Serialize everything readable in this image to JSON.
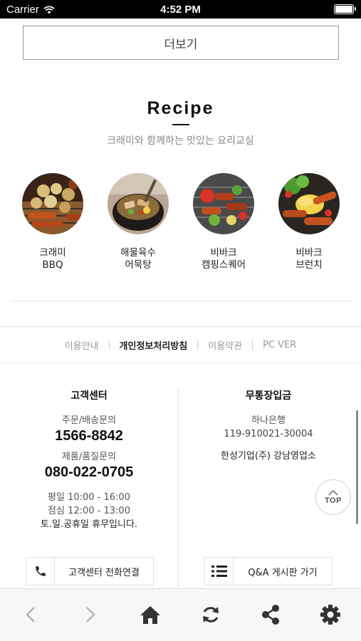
{
  "status_bar": {
    "carrier": "Carrier",
    "time": "4:52 PM"
  },
  "more_button": {
    "label": "더보기"
  },
  "recipe": {
    "title": "Recipe",
    "subtitle": "크래미와 함께하는 맛있는 요리교실",
    "items": [
      {
        "line1": "크래미",
        "line2": "BBQ"
      },
      {
        "line1": "해물육수",
        "line2": "어묵탕"
      },
      {
        "line1": "비바크",
        "line2": "캠핑스퀘어"
      },
      {
        "line1": "비바크",
        "line2": "브런치"
      }
    ]
  },
  "footer_links": [
    "이용안내",
    "개인정보처리방침",
    "이용약관",
    "PC VER"
  ],
  "customer_center": {
    "title": "고객센터",
    "order_label": "주문/배송문의",
    "order_phone": "1566-8842",
    "product_label": "제품/품질문의",
    "product_phone": "080-022-0705",
    "weekday": "평일 10:00 - 16:00",
    "lunch": "점심 12:00 - 13:00",
    "holiday": "토.일.공휴일 휴무입니다.",
    "call_button": "고객센터 전화연결"
  },
  "bank": {
    "title": "무통장입금",
    "bank_name": "하나은행",
    "account": "119-910021-30004",
    "holder": "한성기업(주) 강남영업소",
    "qa_button": "Q&A 게시판 가기"
  },
  "top_button": {
    "label": "TOP"
  },
  "icons": {
    "back": "chevron-left-icon",
    "forward": "chevron-right-icon",
    "home": "home-icon",
    "refresh": "refresh-icon",
    "share": "share-icon",
    "settings": "gear-icon"
  }
}
